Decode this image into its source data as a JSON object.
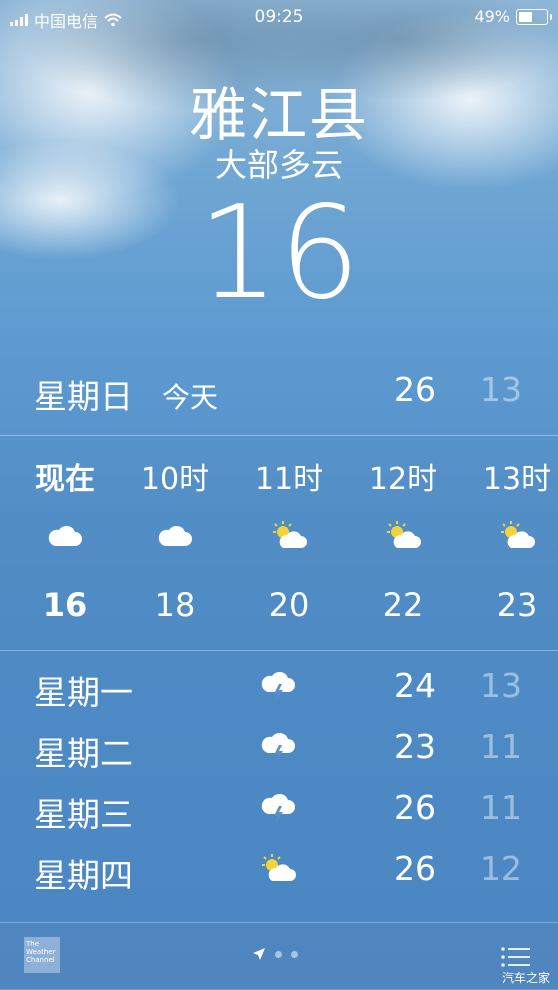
{
  "status_bar": {
    "carrier": "中国电信",
    "time": "09:25",
    "battery_text": "49%",
    "battery_level": 0.49,
    "wifi_icon": "wifi-icon"
  },
  "location": {
    "city": "雅江县",
    "condition": "大部多云",
    "current_temp": "16"
  },
  "today": {
    "day": "星期日",
    "tag": "今天",
    "high": "26",
    "low": "13"
  },
  "hourly": [
    {
      "time": "现在",
      "icon": "cloud-icon",
      "temp": "16"
    },
    {
      "time": "10时",
      "icon": "cloud-icon",
      "temp": "18"
    },
    {
      "time": "11时",
      "icon": "partly-sunny-icon",
      "temp": "20"
    },
    {
      "time": "12时",
      "icon": "partly-sunny-icon",
      "temp": "22"
    },
    {
      "time": "13时",
      "icon": "partly-sunny-icon",
      "temp": "23"
    }
  ],
  "daily": [
    {
      "day": "星期一",
      "icon": "thunderstorm-icon",
      "high": "24",
      "low": "13"
    },
    {
      "day": "星期二",
      "icon": "thunderstorm-icon",
      "high": "23",
      "low": "11"
    },
    {
      "day": "星期三",
      "icon": "thunderstorm-icon",
      "high": "26",
      "low": "11"
    },
    {
      "day": "星期四",
      "icon": "partly-sunny-icon",
      "high": "26",
      "low": "12"
    }
  ],
  "bottom_bar": {
    "provider_logo_text": "The Weather Channel",
    "location_icon": "location-arrow-icon",
    "menu_icon": "list-icon"
  },
  "watermark": "汽车之家"
}
